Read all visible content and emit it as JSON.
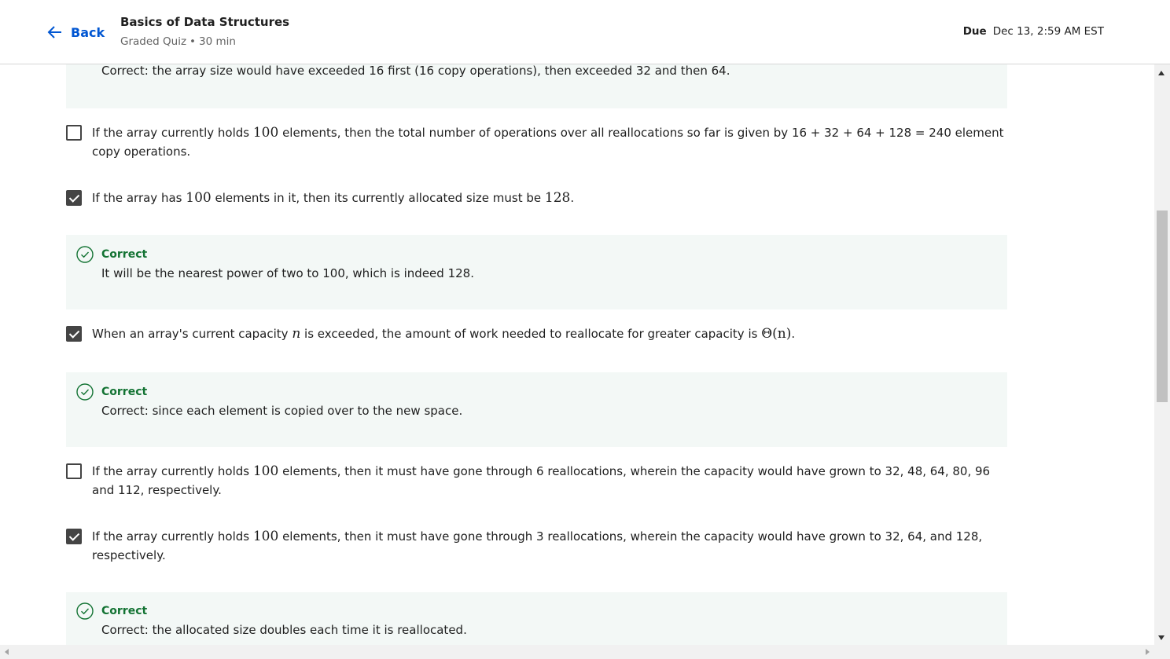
{
  "header": {
    "back_label": "Back",
    "title": "Basics of Data Structures",
    "subtitle_type": "Graded Quiz",
    "subtitle_separator": "•",
    "subtitle_duration": "30 min",
    "due_label": "Due",
    "due_value": "Dec 13, 2:59 AM EST"
  },
  "feedback_top": {
    "text": "Correct: the array size would have exceeded 16 first (16 copy operations), then exceeded 32 and then 64."
  },
  "options": [
    {
      "checked": false,
      "text_before": "If the array currently holds ",
      "math": "100",
      "text_after": " elements, then the total number of operations over all reallocations so far is given by 16 + 32 + 64  + 128 = 240 element copy operations."
    },
    {
      "checked": true,
      "text_before": "If the array has ",
      "math": "100",
      "text_after": " elements in it, then its currently allocated size must be ",
      "math2": "128",
      "text_end": ".",
      "feedback_title": "Correct",
      "feedback_text": "It will be the nearest power of two to 100, which is indeed 128."
    },
    {
      "checked": true,
      "text_before": "When an array's current capacity ",
      "math": "n",
      "text_after": " is exceeded, the amount of work needed to reallocate for greater capacity is ",
      "math2": "Θ(n)",
      "text_end": ".",
      "feedback_title": "Correct",
      "feedback_text": "Correct: since each element is copied over to the new space."
    },
    {
      "checked": false,
      "text_before": "If the array currently holds ",
      "math": "100",
      "text_after": " elements, then it must have gone through 6 reallocations, wherein the capacity would have grown to 32, 48,  64, 80, 96 and 112, respectively."
    },
    {
      "checked": true,
      "text_before": "If the array currently holds ",
      "math": "100",
      "text_after": " elements, then it must have gone through 3 reallocations, wherein the capacity would have grown to 32, 64, and 128, respectively.",
      "feedback_title": "Correct",
      "feedback_text": "Correct: the allocated size doubles each time it is reallocated."
    }
  ],
  "colors": {
    "accent": "#0056d2",
    "correct": "#137333",
    "feedback_bg": "#f3f8f6"
  },
  "icons": {
    "back": "arrow-left-icon",
    "correct": "check-circle-icon"
  }
}
